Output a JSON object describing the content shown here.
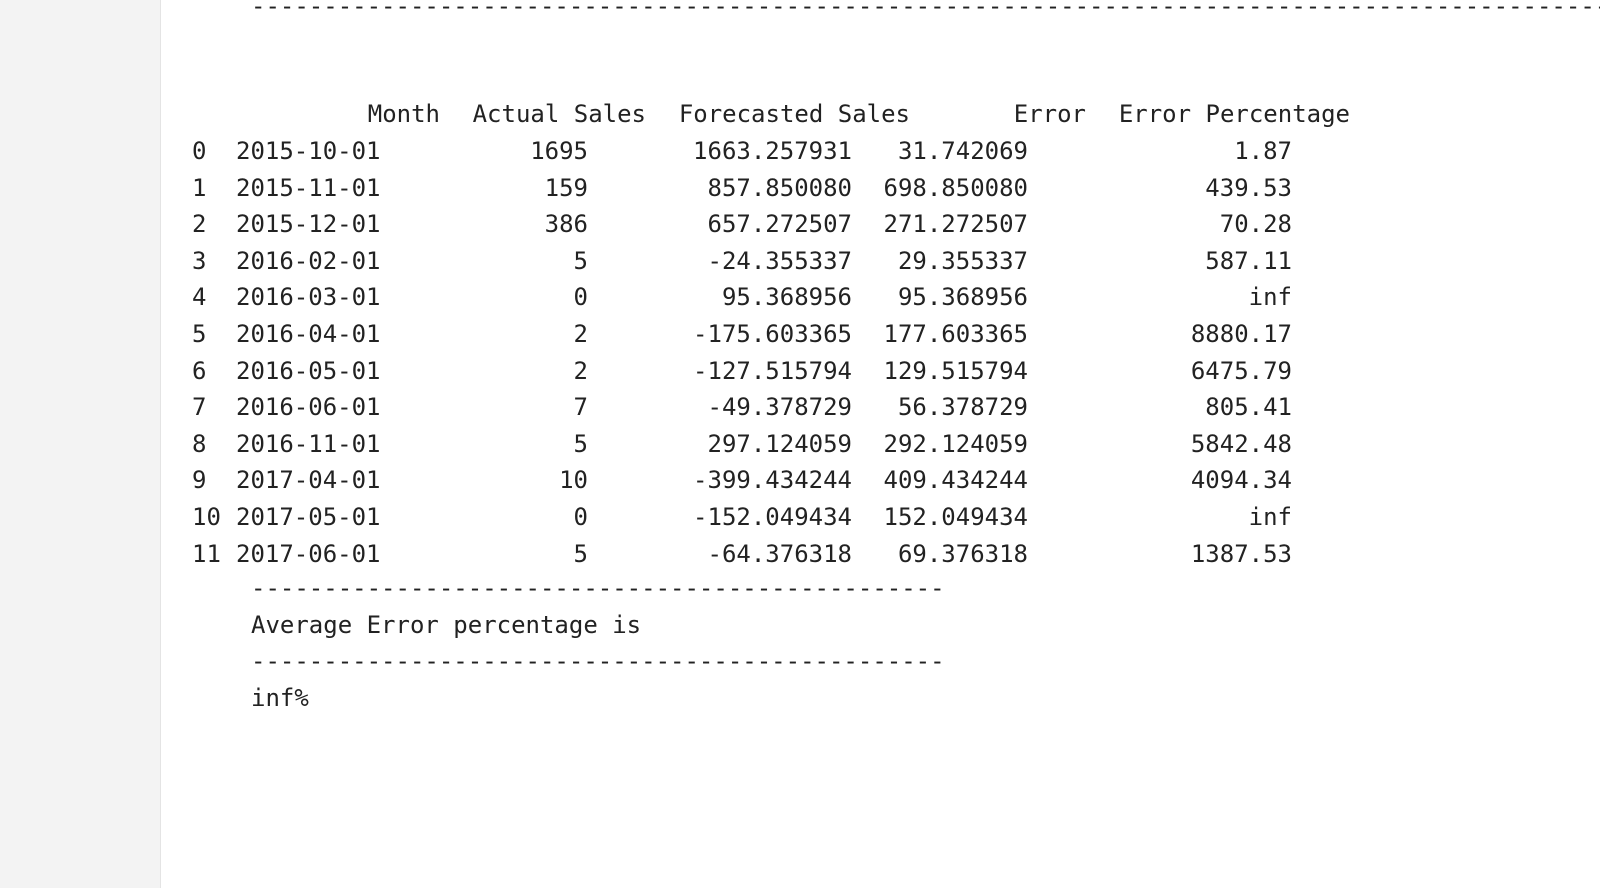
{
  "output": {
    "separator_top": "-----------------------------------------------------------------------------------------------------------",
    "table": {
      "headers": [
        "Month",
        "Actual Sales",
        "Forecasted Sales",
        "Error",
        "Error Percentage"
      ],
      "rows": [
        {
          "index": "0",
          "month": "2015-10-01",
          "actual": "1695",
          "forecast": "1663.257931",
          "error": "31.742069",
          "pct": "1.87"
        },
        {
          "index": "1",
          "month": "2015-11-01",
          "actual": "159",
          "forecast": "857.850080",
          "error": "698.850080",
          "pct": "439.53"
        },
        {
          "index": "2",
          "month": "2015-12-01",
          "actual": "386",
          "forecast": "657.272507",
          "error": "271.272507",
          "pct": "70.28"
        },
        {
          "index": "3",
          "month": "2016-02-01",
          "actual": "5",
          "forecast": "-24.355337",
          "error": "29.355337",
          "pct": "587.11"
        },
        {
          "index": "4",
          "month": "2016-03-01",
          "actual": "0",
          "forecast": "95.368956",
          "error": "95.368956",
          "pct": "inf"
        },
        {
          "index": "5",
          "month": "2016-04-01",
          "actual": "2",
          "forecast": "-175.603365",
          "error": "177.603365",
          "pct": "8880.17"
        },
        {
          "index": "6",
          "month": "2016-05-01",
          "actual": "2",
          "forecast": "-127.515794",
          "error": "129.515794",
          "pct": "6475.79"
        },
        {
          "index": "7",
          "month": "2016-06-01",
          "actual": "7",
          "forecast": "-49.378729",
          "error": "56.378729",
          "pct": "805.41"
        },
        {
          "index": "8",
          "month": "2016-11-01",
          "actual": "5",
          "forecast": "297.124059",
          "error": "292.124059",
          "pct": "5842.48"
        },
        {
          "index": "9",
          "month": "2017-04-01",
          "actual": "10",
          "forecast": "-399.434244",
          "error": "409.434244",
          "pct": "4094.34"
        },
        {
          "index": "10",
          "month": "2017-05-01",
          "actual": "0",
          "forecast": "-152.049434",
          "error": "152.049434",
          "pct": "inf"
        },
        {
          "index": "11",
          "month": "2017-06-01",
          "actual": "5",
          "forecast": "-64.376318",
          "error": "69.376318",
          "pct": "1387.53"
        }
      ]
    },
    "separator_1": "------------------------------------------------",
    "avg_label": "Average Error percentage is",
    "separator_2": "------------------------------------------------",
    "avg_value": "inf%"
  }
}
